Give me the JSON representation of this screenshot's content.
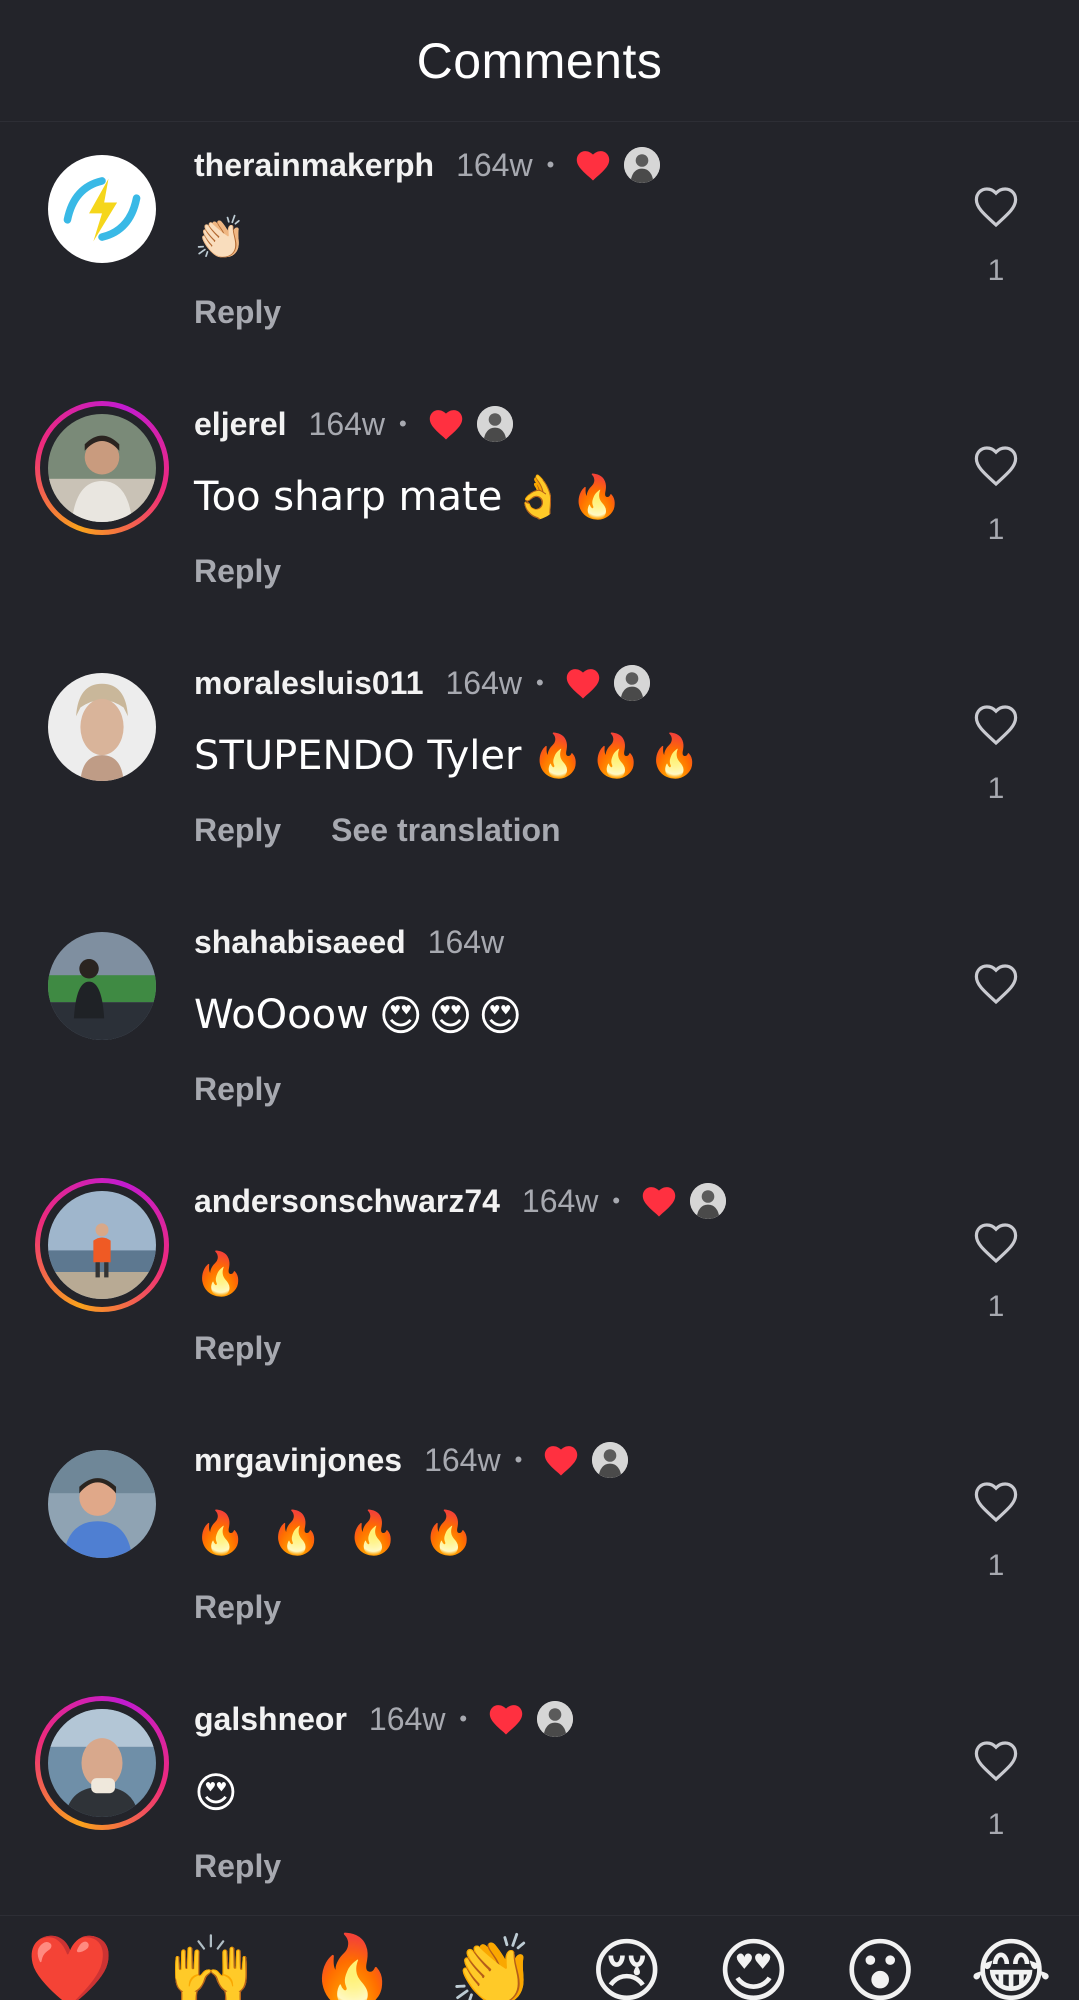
{
  "header": {
    "title": "Comments"
  },
  "comments": [
    {
      "username": "therainmakerph",
      "time": "164w",
      "text": "",
      "emojis": [
        "👏🏻"
      ],
      "liked_by_author": true,
      "reply_label": "Reply",
      "translation_label": "",
      "like_count": "1"
    },
    {
      "username": "eljerel",
      "time": "164w",
      "text": "Too sharp mate",
      "emojis": [
        "👌",
        "🔥"
      ],
      "liked_by_author": true,
      "reply_label": "Reply",
      "translation_label": "",
      "like_count": "1"
    },
    {
      "username": "moralesluis011",
      "time": "164w",
      "text": "STUPENDO Tyler",
      "emojis": [
        "🔥",
        "🔥",
        "🔥"
      ],
      "liked_by_author": true,
      "reply_label": "Reply",
      "translation_label": "See translation",
      "like_count": "1"
    },
    {
      "username": "shahabisaeed",
      "time": "164w",
      "text": "WoOoow",
      "emojis": [
        "😍",
        "😍",
        "😍"
      ],
      "liked_by_author": false,
      "reply_label": "Reply",
      "translation_label": "",
      "like_count": ""
    },
    {
      "username": "andersonschwarz74",
      "time": "164w",
      "text": "",
      "emojis": [
        "🔥"
      ],
      "liked_by_author": true,
      "reply_label": "Reply",
      "translation_label": "",
      "like_count": "1"
    },
    {
      "username": "mrgavinjones",
      "time": "164w",
      "text": "",
      "emojis": [
        "🔥",
        "🔥",
        "🔥",
        "🔥"
      ],
      "liked_by_author": true,
      "reply_label": "Reply",
      "translation_label": "",
      "like_count": "1"
    },
    {
      "username": "galshneor",
      "time": "164w",
      "text": "",
      "emojis": [
        "😍"
      ],
      "liked_by_author": true,
      "reply_label": "Reply",
      "translation_label": "",
      "like_count": "1"
    }
  ],
  "quick_reactions": [
    "❤️",
    "🙌",
    "🔥",
    "👏",
    "😢",
    "😍",
    "😮",
    "😂"
  ],
  "colors": {
    "background": "#23242a",
    "muted_text": "#a7a9b0",
    "heart_red": "#ff3040",
    "story_ring": "#ee2a7b"
  },
  "icons": {
    "like": "heart-outline-icon",
    "author_like": "heart-filled-icon"
  }
}
